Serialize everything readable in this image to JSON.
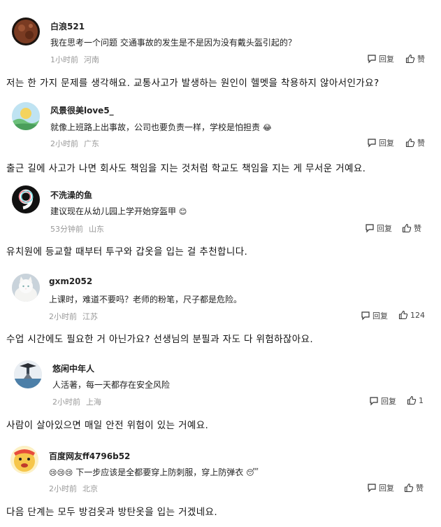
{
  "comments": [
    {
      "username": "白浪521",
      "text": "我在思考一个问题 交通事故的发生是不是因为没有戴头盔引起的？",
      "time": "1小时前",
      "location": "河南",
      "reply_label": "回复",
      "like_label": "赞",
      "like_count": "",
      "translation": "저는 한 가지 문제를 생각해요. 교통사고가 발생하는 원인이 헬멧을 착용하지 않아서인가요?",
      "avatar_icon": "moon-avatar"
    },
    {
      "username": "风景很美love5_",
      "text": "就像上班路上出事故，公司也要负责一样，学校是怕担责",
      "emoji": "😂",
      "time": "2小时前",
      "location": "广东",
      "reply_label": "回复",
      "like_label": "赞",
      "like_count": "",
      "translation": "출근 길에 사고가 나면 회사도 책임을 지는 것처럼 학교도 책임을 지는 게 무서운 거예요.",
      "avatar_icon": "landscape-avatar"
    },
    {
      "username": "不洗澡的鱼",
      "text": "建议现在从幼儿园上学开始穿盔甲",
      "emoji": "😊",
      "time": "53分钟前",
      "location": "山东",
      "reply_label": "回复",
      "like_label": "赞",
      "like_count": "",
      "translation": "유치원에 등교할 때부터 투구와 갑옷을 입는 걸 추천합니다.",
      "avatar_icon": "number-nine-avatar"
    },
    {
      "username": "gxm2052",
      "text": "上课时，难道不要吗？老师的粉笔，尺子都是危险。",
      "time": "2小时前",
      "location": "江苏",
      "reply_label": "回复",
      "like_label": "",
      "like_count": "124",
      "translation": "수업 시간에도 필요한 거 아닌가요? 선생님의 분필과 자도 다 위험하잖아요.",
      "avatar_icon": "white-cat-avatar"
    },
    {
      "username": "悠闲中年人",
      "text": "人活著，每一天都存在安全风险",
      "time": "2小时前",
      "location": "上海",
      "reply_label": "回复",
      "like_label": "",
      "like_count": "1",
      "translation": "사람이 살아있으면 매일 안전 위험이 있는 거예요.",
      "avatar_icon": "person-avatar"
    },
    {
      "username": "百度网友ff4796b52",
      "text": "下一步应该是全都要穿上防刺服，穿上防弹衣",
      "emoji_prefix": "😢😢😢",
      "emoji": "😴",
      "time": "2小时前",
      "location": "北京",
      "reply_label": "回复",
      "like_label": "赞",
      "like_count": "",
      "translation": "다음 단계는 모두 방검옷과 방탄옷을 입는 거겠네요.",
      "avatar_icon": "cartoon-face-avatar"
    }
  ]
}
